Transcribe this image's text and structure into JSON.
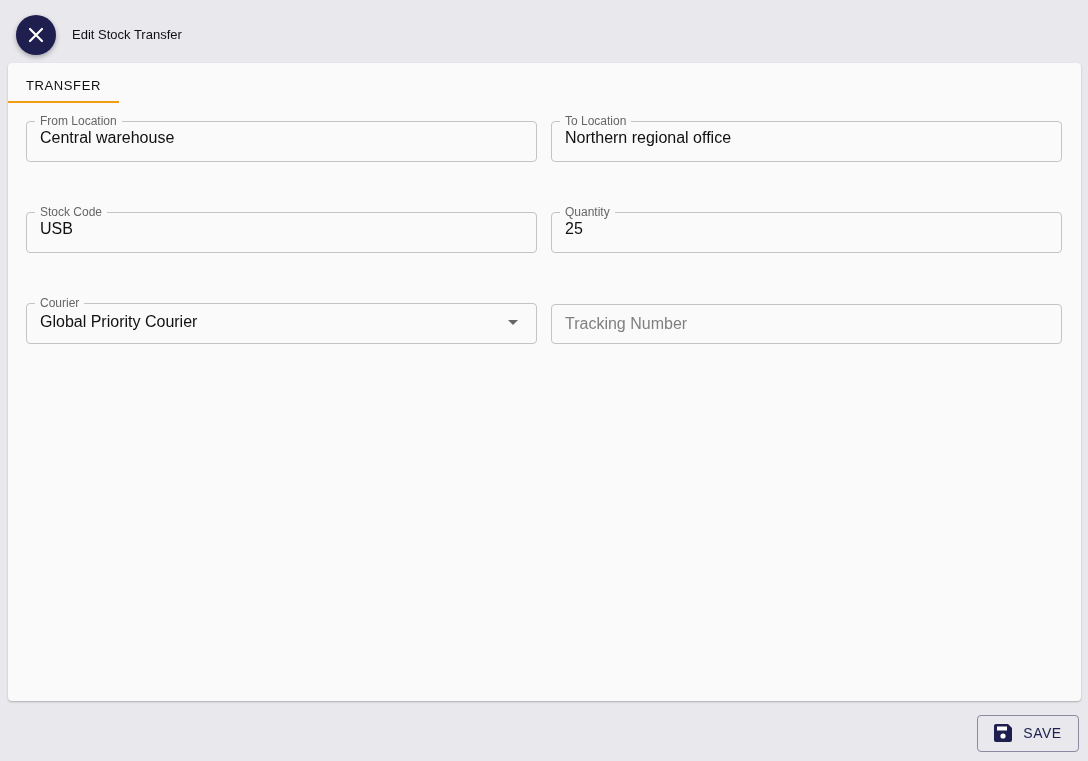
{
  "dialog": {
    "title": "Edit Stock Transfer"
  },
  "tabs": [
    {
      "label": "TRANSFER",
      "selected": true
    }
  ],
  "fields": [
    {
      "kind": "text",
      "label": "From Location",
      "value": "Central warehouse"
    },
    {
      "kind": "text",
      "label": "To Location",
      "value": "Northern regional office"
    },
    {
      "kind": "text",
      "label": "Stock Code",
      "value": "USB"
    },
    {
      "kind": "text",
      "label": "Quantity",
      "value": "25"
    },
    {
      "kind": "select",
      "label": "Courier",
      "value": "Global Priority Courier"
    },
    {
      "kind": "text",
      "placeholder": "Tracking Number"
    }
  ],
  "buttons": [
    {
      "label": "SAVE"
    }
  ]
}
